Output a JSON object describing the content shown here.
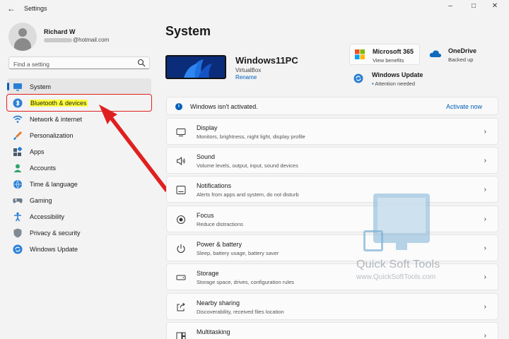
{
  "titlebar": {
    "title": "Settings"
  },
  "profile": {
    "name": "Richard W",
    "email_suffix": "@hotmail.com"
  },
  "search": {
    "placeholder": "Find a setting"
  },
  "sidebar": {
    "items": [
      {
        "label": "System",
        "icon": "monitor-icon"
      },
      {
        "label": "Bluetooth & devices",
        "icon": "bluetooth-icon"
      },
      {
        "label": "Network & internet",
        "icon": "wifi-icon"
      },
      {
        "label": "Personalization",
        "icon": "paintbrush-icon"
      },
      {
        "label": "Apps",
        "icon": "apps-icon"
      },
      {
        "label": "Accounts",
        "icon": "person-icon"
      },
      {
        "label": "Time & language",
        "icon": "globe-clock-icon"
      },
      {
        "label": "Gaming",
        "icon": "gamepad-icon"
      },
      {
        "label": "Accessibility",
        "icon": "accessibility-icon"
      },
      {
        "label": "Privacy & security",
        "icon": "shield-icon"
      },
      {
        "label": "Windows Update",
        "icon": "update-icon"
      }
    ]
  },
  "main": {
    "title": "System",
    "device": {
      "name": "Windows11PC",
      "model": "VirtualBox",
      "rename": "Rename"
    },
    "tiles": {
      "m365": {
        "title": "Microsoft 365",
        "sub": "View benefits"
      },
      "onedrive": {
        "title": "OneDrive",
        "sub": "Backed up"
      },
      "update": {
        "title": "Windows Update",
        "sub": "Attention needed"
      }
    },
    "activation": {
      "message": "Windows isn't activated.",
      "link": "Activate now"
    },
    "settings": [
      {
        "title": "Display",
        "desc": "Monitors, brightness, night light, display profile"
      },
      {
        "title": "Sound",
        "desc": "Volume levels, output, input, sound devices"
      },
      {
        "title": "Notifications",
        "desc": "Alerts from apps and system, do not disturb"
      },
      {
        "title": "Focus",
        "desc": "Reduce distractions"
      },
      {
        "title": "Power & battery",
        "desc": "Sleep, battery usage, battery saver"
      },
      {
        "title": "Storage",
        "desc": "Storage space, drives, configuration rules"
      },
      {
        "title": "Nearby sharing",
        "desc": "Discoverability, received files location"
      },
      {
        "title": "Multitasking",
        "desc": ""
      }
    ]
  },
  "watermark": {
    "line1": "Quick Soft Tools",
    "line2": "www.QuickSoftTools.com"
  },
  "colors": {
    "accent": "#005fb8",
    "highlight": "#ffff3a",
    "annotation": "#e02020"
  }
}
